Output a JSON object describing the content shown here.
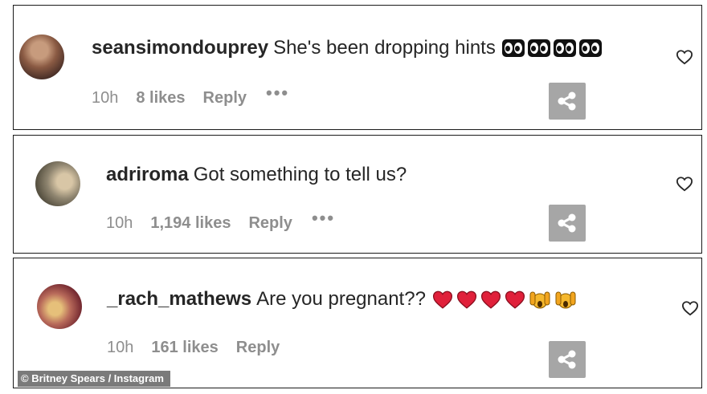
{
  "comments": [
    {
      "username": "seansimondouprey",
      "text": "She's been dropping hints",
      "time": "10h",
      "likes": "8 likes",
      "reply": "Reply",
      "more": "•••",
      "emojis": [
        "eyes-emoji",
        "eyes-emoji",
        "eyes-emoji",
        "eyes-emoji"
      ]
    },
    {
      "username": "adriroma",
      "text": "Got something to tell us?",
      "time": "10h",
      "likes": "1,194 likes",
      "reply": "Reply",
      "more": "•••",
      "emojis": []
    },
    {
      "username": "_rach_mathews",
      "text": "Are you pregnant??",
      "time": "10h",
      "likes": "161 likes",
      "reply": "Reply",
      "more": "",
      "emojis": [
        "red-heart-emoji",
        "red-heart-emoji",
        "red-heart-emoji",
        "red-heart-emoji",
        "screaming-hands-emoji",
        "screaming-hands-emoji"
      ]
    }
  ],
  "caption": "© Britney Spears / Instagram",
  "icons": {
    "like": "heart-outline-icon",
    "share": "share-icon"
  },
  "colors": {
    "username": "#262626",
    "meta": "#8e8e8e",
    "share_bg": "#a6a6a6",
    "heart_emoji": "#e0203a"
  }
}
